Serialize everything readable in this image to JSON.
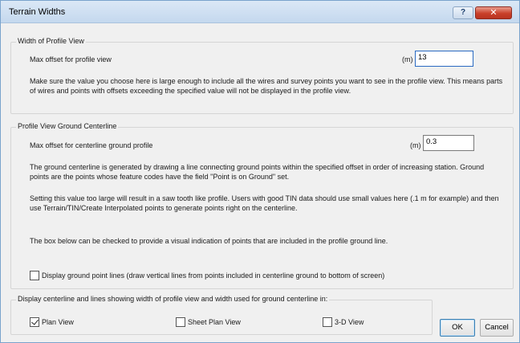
{
  "window": {
    "title": "Terrain Widths",
    "help_label": "?",
    "close_label": "✕"
  },
  "profile_view": {
    "group_title": "Width of Profile View",
    "max_offset_label": "Max offset for profile view",
    "unit": "(m)",
    "max_offset_value": "13",
    "note": "Make sure the value you choose here is large enough to include all the wires and survey points you want to see in the profile view. This means parts of wires and points with offsets exceeding the specified value will not be displayed in the profile view."
  },
  "ground_centerline": {
    "group_title": "Profile View Ground Centerline",
    "max_offset_label": "Max offset for centerline ground profile",
    "unit": "(m)",
    "max_offset_value": "0.3",
    "para1": "The ground centerline is generated by drawing a line connecting ground points within the specified offset in order of increasing station. Ground points are the points whose feature codes have the field \"Point is on Ground\" set.",
    "para2": "Setting this value too large will result in a saw tooth like profile.  Users with good TIN data should use small values here (.1 m for example) and then use Terrain/TIN/Create Interpolated points to generate points right on the centerline.",
    "para3": "The box below can be checked to provide a visual indication of points that are included in the profile ground line.",
    "display_lines_label": "Display ground point lines (draw vertical lines from points included in centerline ground to bottom of screen)",
    "display_lines_checked": false
  },
  "display_in": {
    "group_title": "Display centerline and lines showing width of profile view and width used for ground centerline in:",
    "options": [
      {
        "label": "Plan View",
        "checked": true
      },
      {
        "label": "Sheet Plan View",
        "checked": false
      },
      {
        "label": "3-D View",
        "checked": false
      }
    ]
  },
  "buttons": {
    "ok": "OK",
    "cancel": "Cancel"
  }
}
